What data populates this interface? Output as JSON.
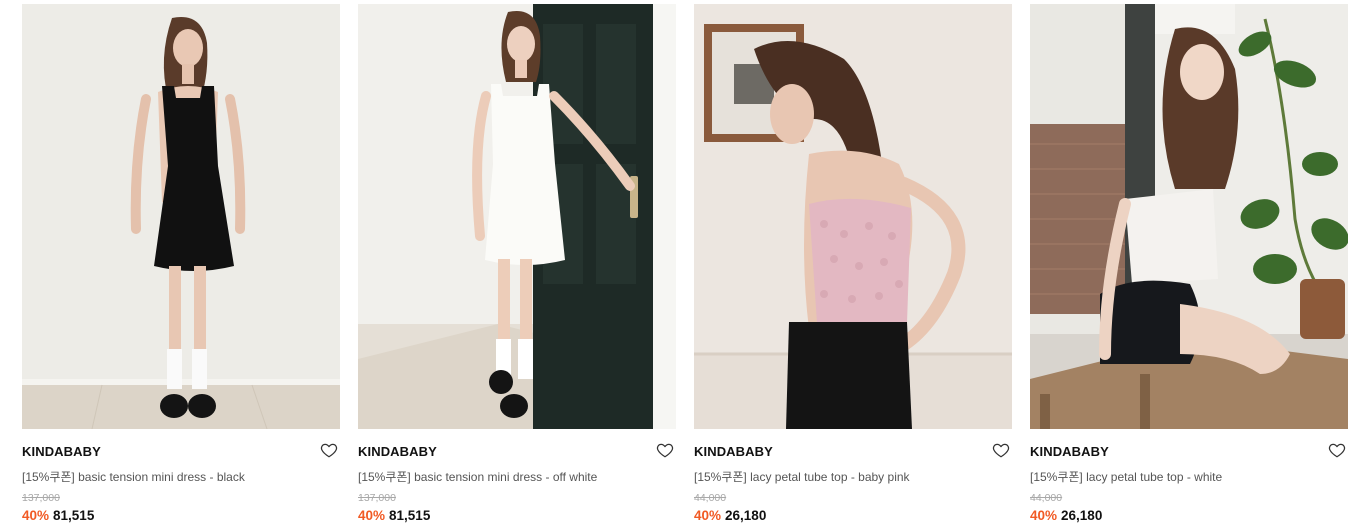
{
  "products": [
    {
      "brand": "KINDABABY",
      "name": "[15%쿠폰] basic tension mini dress - black",
      "original_price": "137,000",
      "discount": "40%",
      "price": "81,515",
      "image": "model in black mini dress against white wall"
    },
    {
      "brand": "KINDABABY",
      "name": "[15%쿠폰] basic tension mini dress - off white",
      "original_price": "137,000",
      "discount": "40%",
      "price": "81,515",
      "image": "model in off white mini dress beside dark green door"
    },
    {
      "brand": "KINDABABY",
      "name": "[15%쿠폰] lacy petal tube top - baby pink",
      "original_price": "44,000",
      "discount": "40%",
      "price": "26,180",
      "image": "model in baby pink tube top"
    },
    {
      "brand": "KINDABABY",
      "name": "[15%쿠폰] lacy petal tube top - white",
      "original_price": "44,000",
      "discount": "40%",
      "price": "26,180",
      "image": "model in white tube top seated by window with plant"
    }
  ],
  "colors": {
    "discount": "#f15a24",
    "brand_text": "#111111",
    "name_text": "#555555",
    "original_price_text": "#a8a8a8"
  },
  "icons": {
    "wishlist": "heart-outline-icon"
  }
}
